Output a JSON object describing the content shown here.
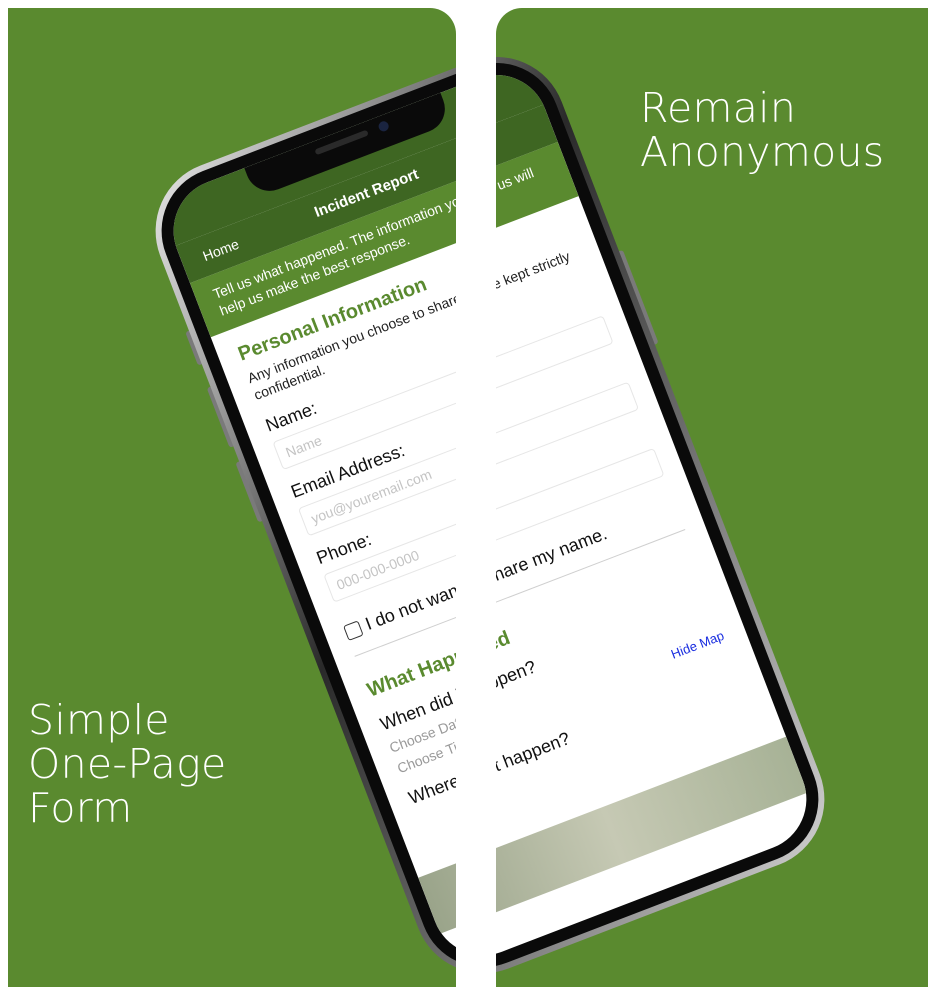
{
  "panels": {
    "left_caption": "Simple\nOne-Page\nForm",
    "right_caption": "Remain\nAnonymous"
  },
  "app": {
    "nav": {
      "back_label": "Home",
      "title": "Incident Report"
    },
    "intro_text": "Tell us what happened. The information you give us will help us make the best response.",
    "personal": {
      "section_title": "Personal Information",
      "section_desc": "Any information you choose to share will be kept strictly confidential.",
      "name_label": "Name:",
      "name_placeholder": "Name",
      "email_label": "Email Address:",
      "email_placeholder": "you@youremail.com",
      "phone_label": "Phone:",
      "phone_placeholder": "000-000-0000",
      "anonymous_checkbox_label": "I do not want to share my name."
    },
    "happened": {
      "section_title": "What Happened",
      "when_label": "When did it happen?",
      "date_placeholder": "Choose Date",
      "time_placeholder": "Choose Time",
      "hide_map_label": "Hide Map",
      "where_label": "Where did it happen?"
    }
  },
  "colors": {
    "panel_green": "#5a8a2f",
    "navbar_green": "#3e6622",
    "section_title_green": "#5a8a2f",
    "link_blue": "#1a2ee0"
  }
}
